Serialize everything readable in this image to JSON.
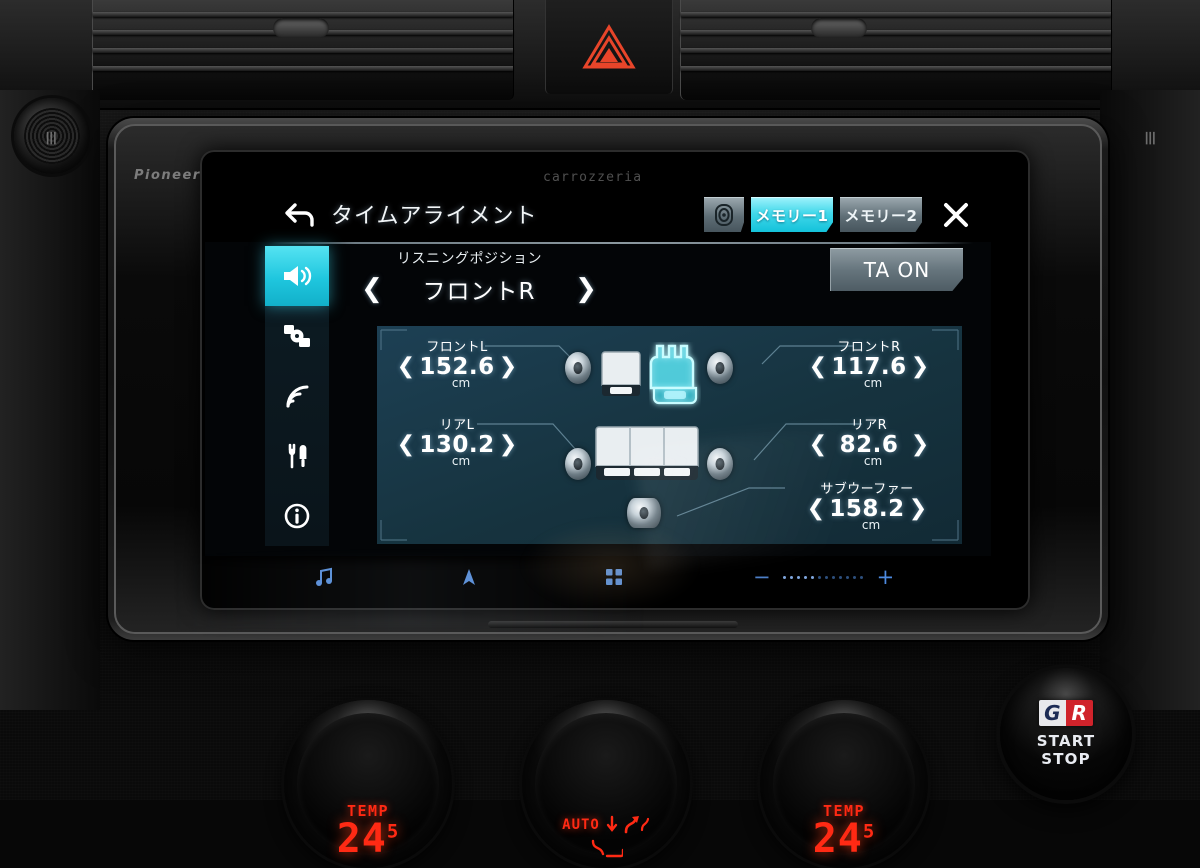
{
  "dashboard": {
    "hazard_button": "hazard-triangle",
    "brand_left": "Pioneer",
    "brand_center": "carrozzeria",
    "start_stop": {
      "logo_left": "G",
      "logo_right": "R",
      "line1": "START",
      "line2": "STOP"
    },
    "climate": [
      {
        "caption": "TEMP",
        "value": "24",
        "decimal": "5"
      },
      {
        "caption": "AUTO",
        "value": "",
        "decimal": ""
      },
      {
        "caption": "TEMP",
        "value": "24",
        "decimal": "5"
      }
    ]
  },
  "header": {
    "back_icon": "back-arrow-icon",
    "title": "タイムアライメント",
    "car_button_icon": "car-position-icon",
    "memory1": "メモリー1",
    "memory2": "メモリー2",
    "active_memory": "メモリー1",
    "close_icon": "close-x-icon"
  },
  "sidebar": {
    "items": [
      {
        "name": "audio",
        "icon": "speaker-icon",
        "active": true
      },
      {
        "name": "source",
        "icon": "media-source-icon",
        "active": false
      },
      {
        "name": "wireless",
        "icon": "signal-waves-icon",
        "active": false
      },
      {
        "name": "settings",
        "icon": "tools-icon",
        "active": false
      },
      {
        "name": "information",
        "icon": "info-icon",
        "active": false
      }
    ]
  },
  "listening_position": {
    "label": "リスニングポジション",
    "value": "フロントR",
    "prev_icon": "chevron-left-icon",
    "next_icon": "chevron-right-icon"
  },
  "ta_button": {
    "label": "TA ON",
    "state": "on"
  },
  "speakers": [
    {
      "id": "front-left",
      "label": "フロントL",
      "value": "152.6",
      "unit": "cm"
    },
    {
      "id": "front-right",
      "label": "フロントR",
      "value": "117.6",
      "unit": "cm"
    },
    {
      "id": "rear-left",
      "label": "リアL",
      "value": "130.2",
      "unit": "cm"
    },
    {
      "id": "rear-right",
      "label": "リアR",
      "value": "82.6",
      "unit": "cm"
    },
    {
      "id": "subwoofer",
      "label": "サブウーファー",
      "value": "158.2",
      "unit": "cm"
    }
  ],
  "diagram": {
    "highlighted_seat": "front-right",
    "seats": [
      "front-left",
      "front-right",
      "rear-bench"
    ],
    "speaker_positions": [
      "front-left",
      "front-right",
      "rear-left",
      "rear-right",
      "subwoofer"
    ]
  },
  "bottom_bar": {
    "music_icon": "music-note-icon",
    "nav_icon": "navigation-arrow-icon",
    "apps_icon": "apps-grid-icon",
    "volume_down": "−",
    "volume_up": "+",
    "volume_dots_total": 12,
    "volume_dots_on": 5
  },
  "colors": {
    "accent_cyan": "#2fd3e8",
    "panel_blue": "#1d4054",
    "led_red": "#ff2a14",
    "bar_blue": "#5a8fd8"
  }
}
